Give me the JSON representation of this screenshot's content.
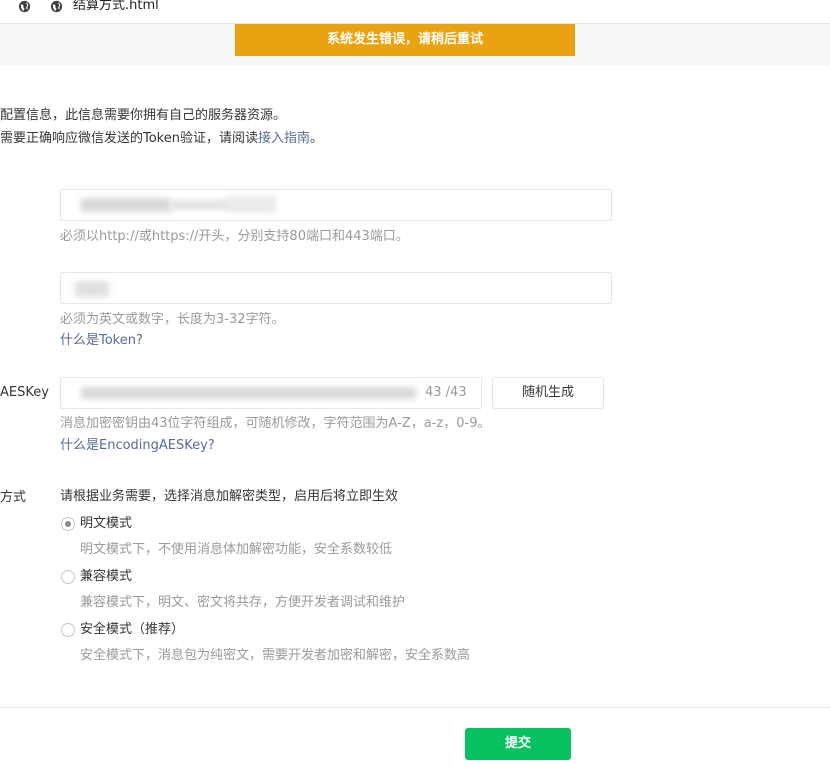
{
  "tab": {
    "title": "结算方式.html",
    "icons": [
      "globe-icon",
      "globe-icon"
    ]
  },
  "banner": {
    "text": "系统发生错误，请稍后重试",
    "color": "#eba211"
  },
  "intro": {
    "line1": "配置信息，此信息需要你拥有自己的服务器资源。",
    "line2_prefix": "需要正确响应微信发送的Token验证，请阅读",
    "line2_link": "接入指南",
    "line2_suffix": "。"
  },
  "url_field": {
    "value": "",
    "hint": "必须以http://或https://开头，分别支持80端口和443端口。"
  },
  "token_field": {
    "value": "",
    "hint": "必须为英文或数字，长度为3-32字符。",
    "help": "什么是Token?"
  },
  "aes_field": {
    "label": "AESKey",
    "value": "",
    "counter": "43 /43",
    "random_button": "随机生成",
    "hint": "消息加密密钥由43位字符组成，可随机修改，字符范围为A-Z，a-z，0-9。",
    "help": "什么是EncodingAESKey?"
  },
  "mode": {
    "label": "方式",
    "intro": "请根据业务需要，选择消息加解密类型，启用后将立即生效",
    "options": [
      {
        "label": "明文模式",
        "desc": "明文模式下，不使用消息体加解密功能，安全系数较低",
        "checked": true
      },
      {
        "label": "兼容模式",
        "desc": "兼容模式下，明文、密文将共存，方便开发者调试和维护",
        "checked": false
      },
      {
        "label": "安全模式（推荐）",
        "desc": "安全模式下，消息包为纯密文，需要开发者加密和解密，安全系数高",
        "checked": false
      }
    ]
  },
  "footer": {
    "submit": "提交",
    "submit_color": "#07c160"
  }
}
